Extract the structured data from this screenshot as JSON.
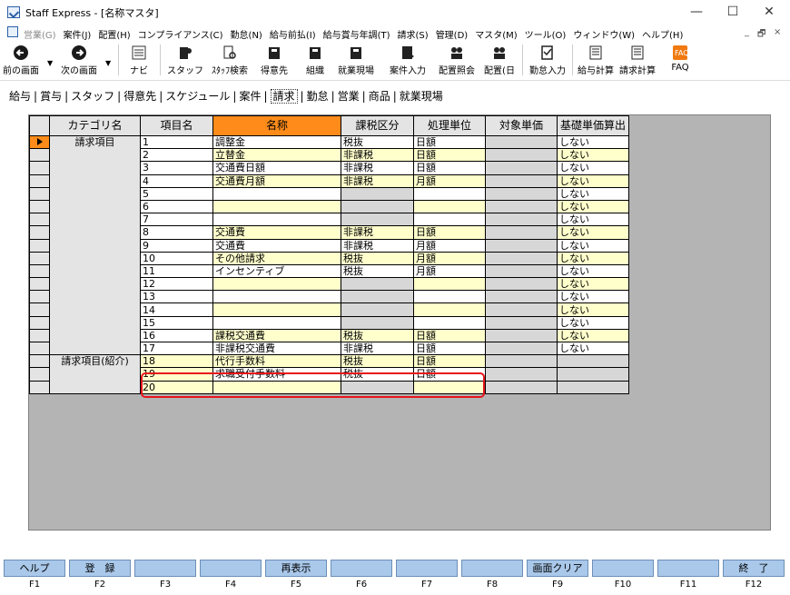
{
  "window": {
    "title": "Staff Express - [名称マスタ]",
    "minimize": "—",
    "maximize": "☐",
    "close": "✕"
  },
  "menu": {
    "items": [
      "営業(G)",
      "案件(J)",
      "配置(H)",
      "コンプライアンス(C)",
      "勤怠(N)",
      "給与前払(I)",
      "給与賞与年調(T)",
      "請求(S)",
      "管理(D)",
      "マスタ(M)",
      "ツール(O)",
      "ウィンドウ(W)",
      "ヘルプ(H)"
    ],
    "mdi_min": "_",
    "mdi_restore": "🗗",
    "mdi_close": "×"
  },
  "toolbar": {
    "prev": "前の画面",
    "next": "次の画面",
    "navi": "ナビ",
    "staff": "スタッフ",
    "staff_search": "ｽﾀｯﾌ検索",
    "customer": "得意先",
    "org": "組織",
    "workplace": "就業現場",
    "case_input": "案件入力",
    "assign_ref": "配置照会",
    "assign_day": "配置(日",
    "attendance_input": "勤怠入力",
    "pay_calc": "給与計算",
    "bill_calc": "請求計算",
    "faq": "FAQ"
  },
  "tabs": [
    "給与",
    "賞与",
    "スタッフ",
    "得意先",
    "スケジュール",
    "案件",
    "請求",
    "勤怠",
    "営業",
    "商品",
    "就業現場"
  ],
  "active_tab": "請求",
  "grid": {
    "headers": [
      "カテゴリ名",
      "項目名",
      "名称",
      "課税区分",
      "処理単位",
      "対象単価",
      "基礎単価算出"
    ],
    "category1": "請求項目",
    "category2": "請求項目(紹介)",
    "rows": [
      {
        "no": "1",
        "name": "調整金",
        "tax": "税抜",
        "unit": "日額",
        "price": "",
        "base": "しない"
      },
      {
        "no": "2",
        "name": "立替金",
        "tax": "非課税",
        "unit": "日額",
        "price": "",
        "base": "しない"
      },
      {
        "no": "3",
        "name": "交通費日額",
        "tax": "非課税",
        "unit": "日額",
        "price": "",
        "base": "しない"
      },
      {
        "no": "4",
        "name": "交通費月額",
        "tax": "非課税",
        "unit": "月額",
        "price": "",
        "base": "しない"
      },
      {
        "no": "5",
        "name": "",
        "tax": "",
        "unit": "",
        "price": "",
        "base": "しない"
      },
      {
        "no": "6",
        "name": "",
        "tax": "",
        "unit": "",
        "price": "",
        "base": "しない"
      },
      {
        "no": "7",
        "name": "",
        "tax": "",
        "unit": "",
        "price": "",
        "base": "しない"
      },
      {
        "no": "8",
        "name": "交通費",
        "tax": "非課税",
        "unit": "日額",
        "price": "",
        "base": "しない"
      },
      {
        "no": "9",
        "name": "交通費",
        "tax": "非課税",
        "unit": "月額",
        "price": "",
        "base": "しない"
      },
      {
        "no": "10",
        "name": "その他請求",
        "tax": "税抜",
        "unit": "月額",
        "price": "",
        "base": "しない"
      },
      {
        "no": "11",
        "name": "インセンティブ",
        "tax": "税抜",
        "unit": "月額",
        "price": "",
        "base": "しない"
      },
      {
        "no": "12",
        "name": "",
        "tax": "",
        "unit": "",
        "price": "",
        "base": "しない"
      },
      {
        "no": "13",
        "name": "",
        "tax": "",
        "unit": "",
        "price": "",
        "base": "しない"
      },
      {
        "no": "14",
        "name": "",
        "tax": "",
        "unit": "",
        "price": "",
        "base": "しない"
      },
      {
        "no": "15",
        "name": "",
        "tax": "",
        "unit": "",
        "price": "",
        "base": "しない"
      },
      {
        "no": "16",
        "name": "課税交通費",
        "tax": "税抜",
        "unit": "日額",
        "price": "",
        "base": "しない"
      },
      {
        "no": "17",
        "name": "非課税交通費",
        "tax": "非課税",
        "unit": "日額",
        "price": "",
        "base": "しない"
      },
      {
        "no": "18",
        "name": "代行手数料",
        "tax": "税抜",
        "unit": "日額",
        "price": "",
        "base": ""
      },
      {
        "no": "19",
        "name": "求職受付手数料",
        "tax": "税抜",
        "unit": "日額",
        "price": "",
        "base": ""
      },
      {
        "no": "20",
        "name": "",
        "tax": "",
        "unit": "",
        "price": "",
        "base": ""
      }
    ]
  },
  "fkeys": [
    {
      "key": "F1",
      "label": "ヘルプ"
    },
    {
      "key": "F2",
      "label": "登　録"
    },
    {
      "key": "F3",
      "label": ""
    },
    {
      "key": "F4",
      "label": ""
    },
    {
      "key": "F5",
      "label": "再表示"
    },
    {
      "key": "F6",
      "label": ""
    },
    {
      "key": "F7",
      "label": ""
    },
    {
      "key": "F8",
      "label": ""
    },
    {
      "key": "F9",
      "label": "画面クリア"
    },
    {
      "key": "F10",
      "label": ""
    },
    {
      "key": "F11",
      "label": ""
    },
    {
      "key": "F12",
      "label": "終　了"
    }
  ],
  "colors": {
    "header_highlight": "#ff8c1a",
    "input_yellow": "#ffffcc",
    "fkey_blue": "#a9c8ea",
    "annotation_red": "#e8141c"
  }
}
